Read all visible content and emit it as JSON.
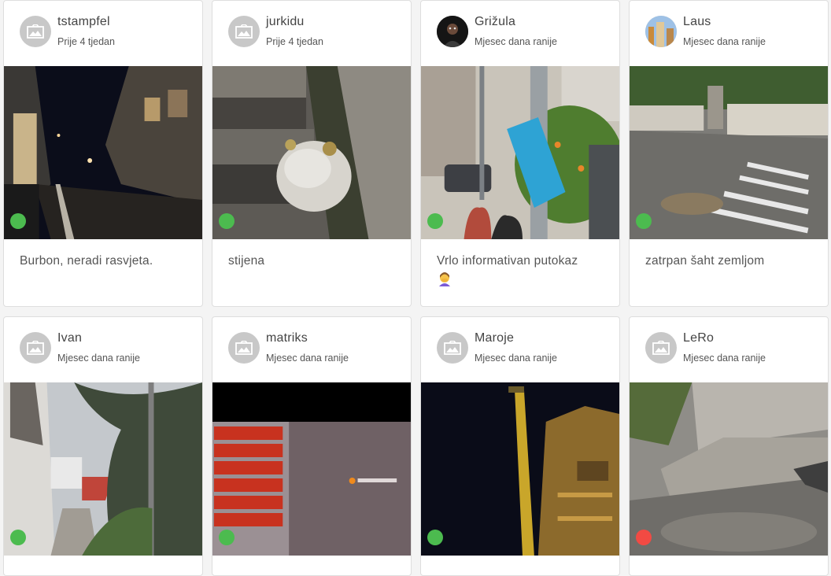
{
  "colors": {
    "status_ok": "#4cbb4f",
    "status_bad": "#f24a43",
    "avatar_bg": "#c8c8c8"
  },
  "icons": {
    "placeholder_avatar": "image-placeholder-icon",
    "reaction": "woman-facepalming-emoji"
  },
  "cards": [
    {
      "user": "tstampfel",
      "date": "Prije 4 tjedan",
      "avatar": "placeholder",
      "status": "ok",
      "description": "Burbon, neradi rasvjeta."
    },
    {
      "user": "jurkidu",
      "date": "Prije 4 tjedan",
      "avatar": "placeholder",
      "status": "ok",
      "description": "stijena"
    },
    {
      "user": "Grižula",
      "date": "Mjesec dana ranije",
      "avatar": "photo",
      "status": "ok",
      "description": "Vrlo informativan putokaz"
    },
    {
      "user": "Laus",
      "date": "Mjesec dana ranije",
      "avatar": "photo",
      "status": "ok",
      "description": "zatrpan šaht zemljom"
    },
    {
      "user": "Ivan",
      "date": "Mjesec dana ranije",
      "avatar": "placeholder",
      "status": "ok",
      "description": ""
    },
    {
      "user": "matriks",
      "date": "Mjesec dana ranije",
      "avatar": "placeholder",
      "status": "ok",
      "description": ""
    },
    {
      "user": "Maroje",
      "date": "Mjesec dana ranije",
      "avatar": "placeholder",
      "status": "ok",
      "description": ""
    },
    {
      "user": "LeRo",
      "date": "Mjesec dana ranije",
      "avatar": "placeholder",
      "status": "bad",
      "description": ""
    }
  ]
}
